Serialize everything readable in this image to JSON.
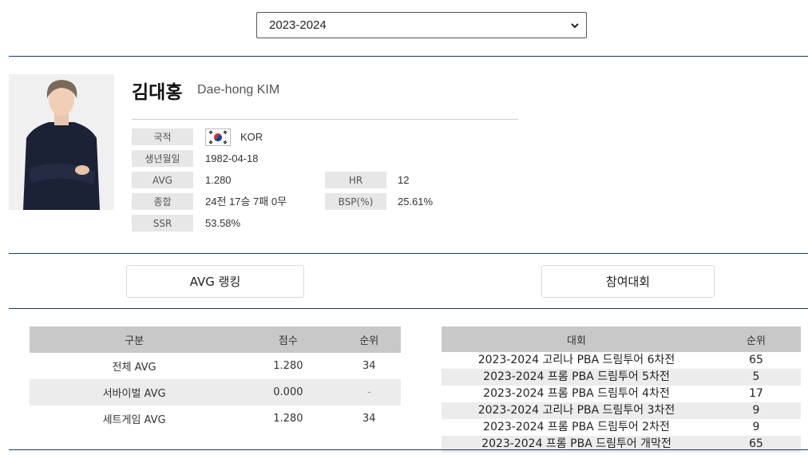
{
  "season": {
    "selected": "2023-2024"
  },
  "player": {
    "name_ko": "김대홍",
    "name_en": "Dae-hong KIM",
    "fields": {
      "nationality": {
        "label": "국적",
        "value": "KOR"
      },
      "birth": {
        "label": "생년월일",
        "value": "1982-04-18"
      },
      "avg": {
        "label": "AVG",
        "value": "1.280"
      },
      "hr": {
        "label": "HR",
        "value": "12"
      },
      "record": {
        "label": "종합",
        "value": "24전 17승 7패 0무"
      },
      "bsp": {
        "label": "BSP(%)",
        "value": "25.61%"
      },
      "ssr": {
        "label": "SSR",
        "value": "53.58%"
      }
    }
  },
  "tabs": {
    "avg_ranking": "AVG 랭킹",
    "tournaments": "참여대회"
  },
  "avg_table": {
    "headers": [
      "구분",
      "점수",
      "순위"
    ],
    "rows": [
      [
        "전체 AVG",
        "1.280",
        "34"
      ],
      [
        "서바이벌 AVG",
        "0.000",
        "-"
      ],
      [
        "세트게임 AVG",
        "1.280",
        "34"
      ]
    ]
  },
  "tournament_table": {
    "headers": [
      "대회",
      "순위"
    ],
    "rows": [
      [
        "2023-2024 고리나 PBA 드림투어 6차전",
        "65"
      ],
      [
        "2023-2024 프롬 PBA 드림투어 5차전",
        "5"
      ],
      [
        "2023-2024 프롬 PBA 드림투어 4차전",
        "17"
      ],
      [
        "2023-2024 고리나 PBA 드림투어 3차전",
        "9"
      ],
      [
        "2023-2024 프롬 PBA 드림투어 2차전",
        "9"
      ],
      [
        "2023-2024 프롬 PBA 드림투어 개막전",
        "65"
      ]
    ]
  },
  "colors": {
    "rule": "#1e3a5f",
    "header_bg": "#c8c8c8",
    "label_bg": "#e7e7e7",
    "alt_row": "#ececec"
  }
}
